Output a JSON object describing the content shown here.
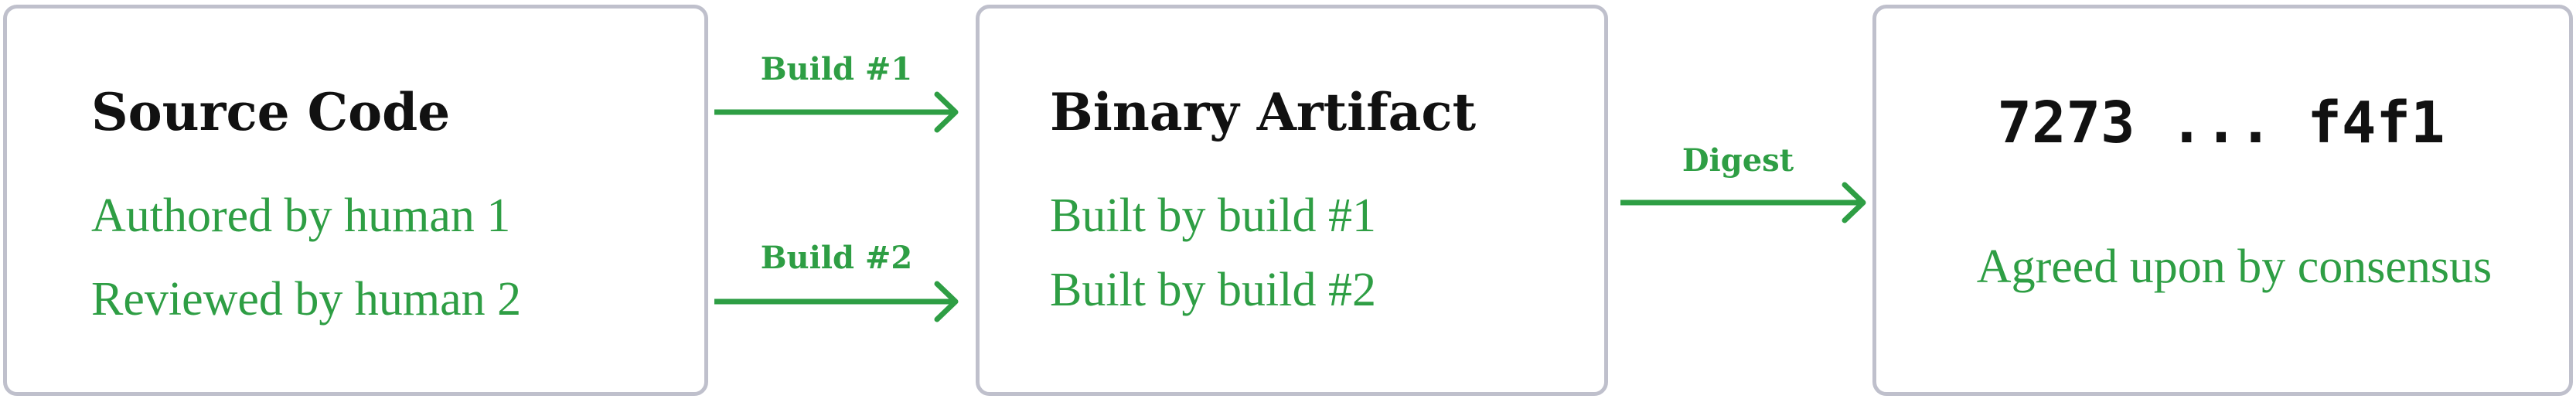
{
  "colors": {
    "accent": "#2e9e44",
    "border": "#bfc0cc",
    "text": "#111111"
  },
  "source": {
    "title": "Source Code",
    "lines": [
      "Authored by human 1",
      "Reviewed by human 2"
    ]
  },
  "binary": {
    "title": "Binary Artifact",
    "lines": [
      "Built by build #1",
      "Built by build #2"
    ]
  },
  "digest_box": {
    "hash": "7273 ... f4f1",
    "line": "Agreed upon by consensus"
  },
  "arrows": {
    "build1": "Build #1",
    "build2": "Build #2",
    "digest": "Digest"
  }
}
